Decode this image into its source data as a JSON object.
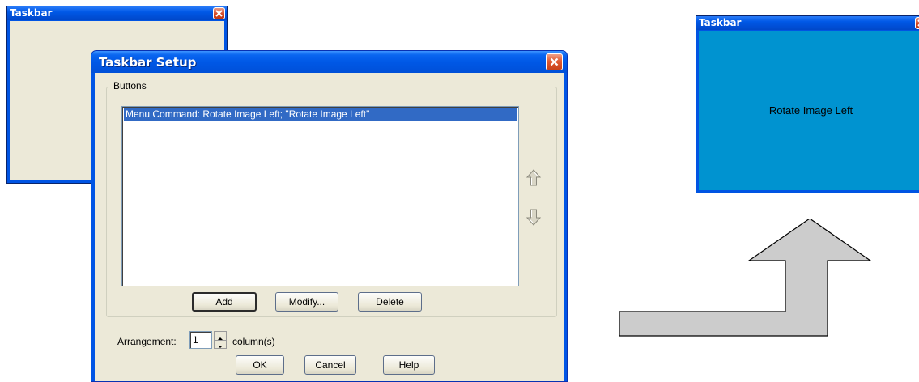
{
  "taskbar_window_left": {
    "title": "Taskbar"
  },
  "dialog": {
    "title": "Taskbar Setup",
    "group_label": "Buttons",
    "list_items": [
      "Menu Command: Rotate Image Left; \"Rotate Image Left\""
    ],
    "buttons": {
      "add": "Add",
      "modify": "Modify...",
      "delete": "Delete",
      "ok": "OK",
      "cancel": "Cancel",
      "help": "Help"
    },
    "arrangement_label": "Arrangement:",
    "arrangement_value": "1",
    "arrangement_unit": "column(s)"
  },
  "taskbar_window_right": {
    "title": "Taskbar",
    "button_label": "Rotate Image Left"
  },
  "colors": {
    "titlebar_blue": "#0058e6",
    "dialog_face": "#ece9d8",
    "selection": "#316ac5",
    "preview_background": "#0093d0",
    "arrow_fill": "#cccccc"
  },
  "icons": [
    "close-icon",
    "move-up-arrow-icon",
    "move-down-arrow-icon",
    "flow-arrow-icon"
  ]
}
